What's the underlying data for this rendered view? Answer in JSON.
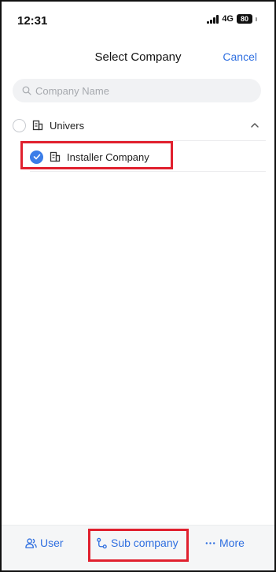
{
  "status_bar": {
    "time": "12:31",
    "network": "4G",
    "battery": "80"
  },
  "nav": {
    "title": "Select Company",
    "cancel_label": "Cancel"
  },
  "search": {
    "placeholder": "Company Name",
    "value": ""
  },
  "tree": {
    "items": [
      {
        "label": "Univers",
        "selected": false,
        "expanded": true
      },
      {
        "label": "Installer Company",
        "selected": true
      }
    ]
  },
  "bottom_tabs": [
    {
      "label": "User",
      "icon": "users-icon"
    },
    {
      "label": "Sub company",
      "icon": "hierarchy-icon"
    },
    {
      "label": "More",
      "icon": "more-dots-icon"
    }
  ],
  "colors": {
    "accent": "#2f6fe0",
    "highlight": "#e0202e",
    "selected": "#3b7de8"
  }
}
